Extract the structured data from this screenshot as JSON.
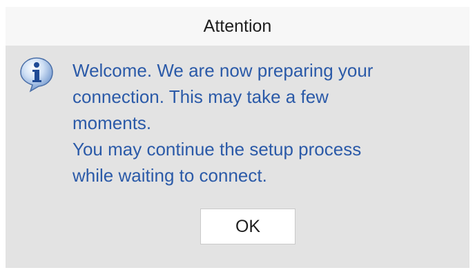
{
  "dialog": {
    "title": "Attention",
    "icon": "info-icon",
    "message_lines": [
      "Welcome. We are now preparing your",
      "connection. This may take a few",
      "moments.",
      "You may continue the setup process",
      "while waiting to connect."
    ],
    "ok_label": "OK"
  },
  "colors": {
    "message_text": "#2b5aa8",
    "dialog_background": "#e3e3e3",
    "titlebar_background": "#f7f7f7"
  }
}
